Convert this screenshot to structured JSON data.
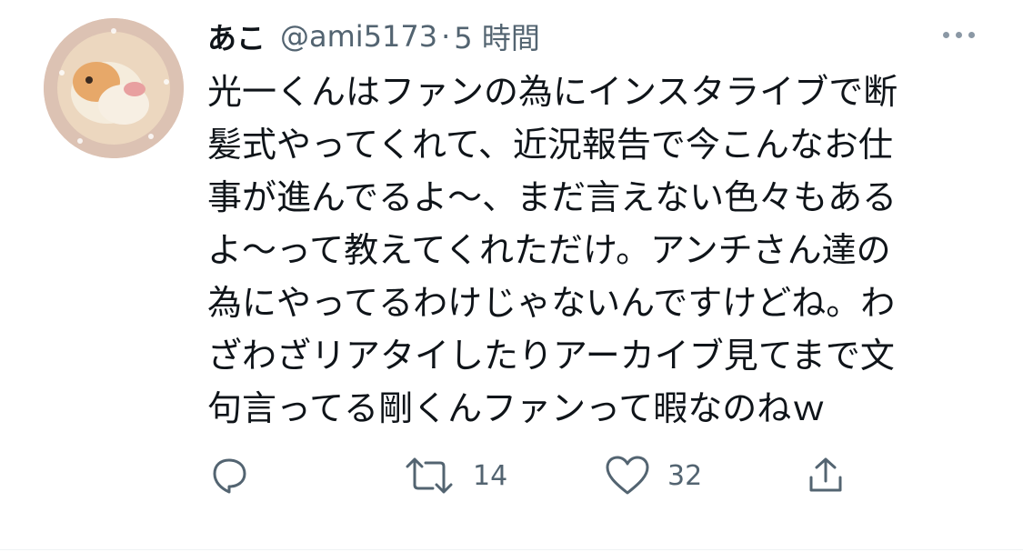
{
  "tweet": {
    "display_name": "あこ",
    "handle": "@ami5173",
    "separator": "·",
    "time": "5 時間",
    "text_lines": [
      "光一くんはファンの為にインスタライブで断",
      "髪式やってくれて、近況報告で今こんなお仕",
      "事が進んでるよ〜、まだ言えない色々もある",
      "よ〜って教えてくれただけ。アンチさん達の",
      "為にやってるわけじゃないんですけどね。わ",
      "ざわざリアタイしたりアーカイブ見てまで文",
      "句言ってる剛くんファンって暇なのねｗ"
    ],
    "retweet_count": "14",
    "like_count": "32"
  },
  "icons": {
    "more": "more-dots-icon",
    "reply": "reply-bubble-icon",
    "retweet": "retweet-icon",
    "like": "heart-icon",
    "share": "share-icon"
  },
  "colors": {
    "text": "#0f1419",
    "secondary": "#536471",
    "background": "#ffffff"
  }
}
